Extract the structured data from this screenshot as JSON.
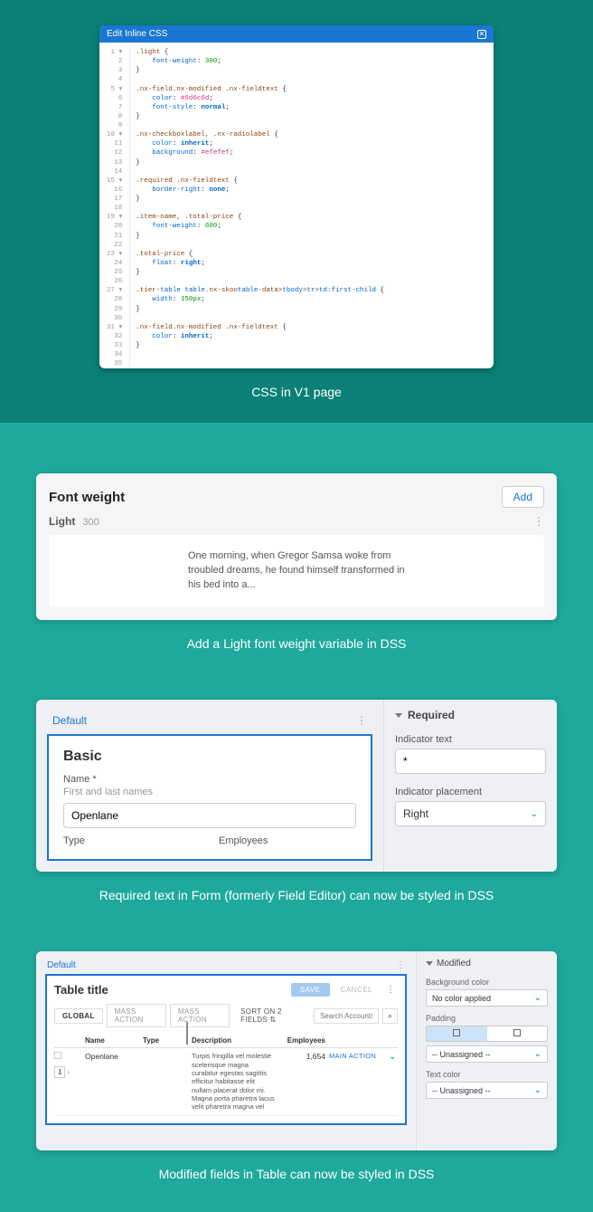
{
  "section1": {
    "title": "Edit Inline CSS",
    "caption": "CSS in V1 page",
    "lines": [
      ".light {",
      "    font-weight: 300;",
      "}",
      "",
      ".nx-field.nx-modified .nx-fieldtext {",
      "    color: #6d6c6d;",
      "    font-style: normal;",
      "}",
      "",
      ".nx-checkboxlabel, .nx-radiolabel {",
      "    color: inherit;",
      "    background: #efefef;",
      "}",
      "",
      ".required .nx-fieldtext {",
      "    border-right: none;",
      "}",
      "",
      ".item-name, .total-price {",
      "    font-weight: 600;",
      "}",
      "",
      ".total-price {",
      "    float:right;",
      "}",
      "",
      ".tier-table table.nx-skootable-data>tbody>tr>td:first-child {",
      "    width: 150px;",
      "}",
      "",
      ".nx-field.nx-modified .nx-fieldtext {",
      "    color: inherit;",
      "}",
      ""
    ]
  },
  "section2": {
    "caption": "Add a Light font weight variable in DSS",
    "title": "Font weight",
    "add": "Add",
    "row_name": "Light",
    "row_val": "300",
    "sample": "One morning, when Gregor Samsa woke from troubled dreams, he found himself transformed in his bed into a..."
  },
  "section3": {
    "caption": "Required text in Form (formerly Field Editor) can now be styled in DSS",
    "tab": "Default",
    "heading": "Basic",
    "name_label": "Name *",
    "name_hint": "First and last names",
    "name_value": "Openlane",
    "col1": "Type",
    "col2": "Employees",
    "right_section": "Required",
    "ind_label": "Indicator text",
    "ind_value": "*",
    "ind_place_label": "Indicator placement",
    "ind_place_value": "Right"
  },
  "section4": {
    "caption": "Modified fields in Table can now be styled in DSS",
    "tab": "Default",
    "title": "Table title",
    "save": "SAVE",
    "cancel": "CANCEL",
    "global": "GLOBAL",
    "mass": "MASS ACTION",
    "sort": "SORT ON 2 FIELDS",
    "search_ph": "Search Accounts",
    "col_name": "Name",
    "col_type": "Type",
    "col_desc": "Description",
    "col_emp": "Employees",
    "row_name": "Openlane",
    "row_emp": "1,654",
    "row_action": "MAIN ACTION",
    "row_num": "1",
    "desc": "Turpis fringilla vel molestie scelerisque magna curabitur egestas sagittis efficitur habitasse elit nullam placerat dolor mi. Magna porta pharetra lacus velit pharetra magna vel",
    "right_section": "Modified",
    "bg_label": "Background color",
    "bg_value": "No color applied",
    "pad_label": "Padding",
    "pad_value": "-- Unassigned --",
    "txt_label": "Text color",
    "txt_value": "-- Unassigned --"
  }
}
